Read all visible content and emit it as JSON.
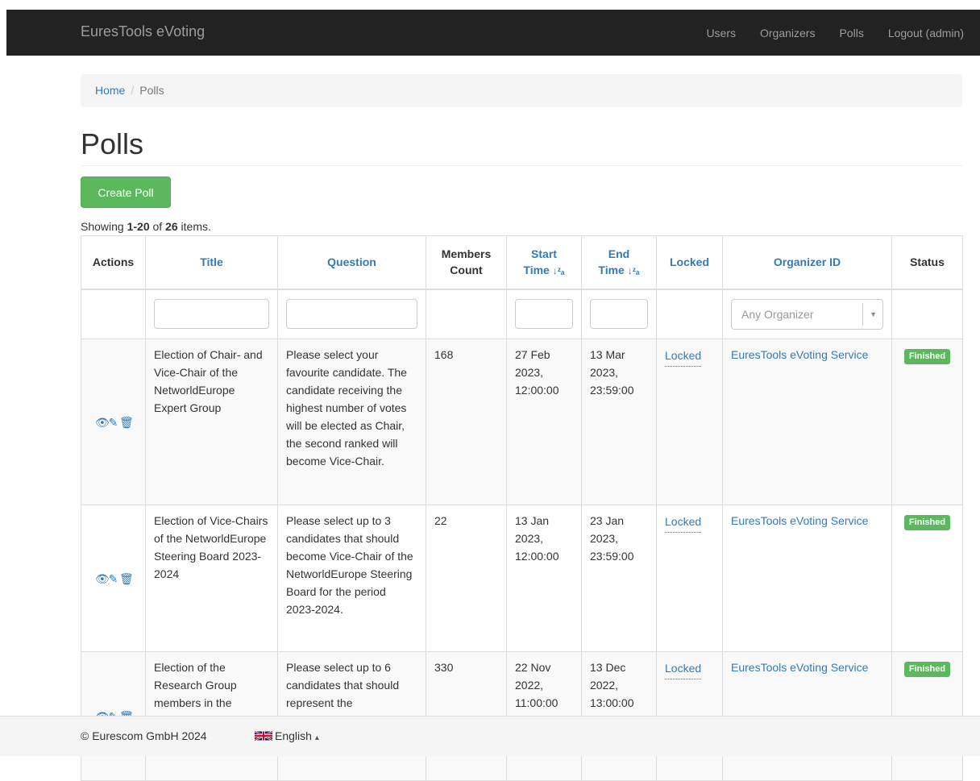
{
  "navbar": {
    "brand": "EuresTools eVoting",
    "links": [
      "Users",
      "Organizers",
      "Polls",
      "Logout (admin)"
    ]
  },
  "breadcrumb": {
    "home": "Home",
    "separator": "/",
    "current": "Polls"
  },
  "page": {
    "title": "Polls",
    "create_button": "Create Poll",
    "summary": {
      "prefix": "Showing ",
      "range": "1-20",
      "middle": " of ",
      "total": "26",
      "suffix": " items."
    }
  },
  "table": {
    "headers": {
      "actions": "Actions",
      "title": "Title",
      "question": "Question",
      "members_line1": "Members",
      "members_line2": "Count",
      "start_line1": "Start",
      "start_line2": "Time",
      "end_line1": "End",
      "end_line2": "Time",
      "locked": "Locked",
      "organizer": "Organizer ID",
      "status": "Status"
    },
    "filters": {
      "organizer_placeholder": "Any Organizer"
    },
    "rows": [
      {
        "title": "Election of Chair- and Vice-Chair of the NetworldEurope Expert Group",
        "question": "Please select your favourite candidate. The candidate receiving the highest number of votes will be elected as Chair, the second ranked will become Vice-Chair.",
        "members": "168",
        "start": "27 Feb 2023, 12:00:00",
        "end": "13 Mar 2023, 23:59:00",
        "locked": "Locked",
        "organizer": "EuresTools eVoting Service",
        "status": "Finished"
      },
      {
        "title": "Election of Vice-Chairs of the NetworldEurope Steering Board 2023-2024",
        "question": "Please select up to 3 candidates that should become Vice-Chair of the NetworldEurope Steering Board for the period 2023-2024.",
        "members": "22",
        "start": "13 Jan 2023, 12:00:00",
        "end": "23 Jan 2023, 23:59:00",
        "locked": "Locked",
        "organizer": "EuresTools eVoting Service",
        "status": "Finished"
      },
      {
        "title": "Election of the Research Group members in the NetworldEurope SRIA",
        "question": "Please select up to 6 candidates that should represent the",
        "members": "330",
        "start": "22 Nov 2022, 11:00:00",
        "end": "13 Dec 2022, 13:00:00",
        "locked": "Locked",
        "organizer": "EuresTools eVoting Service",
        "status": "Finished"
      }
    ]
  },
  "footer": {
    "copyright": "© Eurescom GmbH 2024",
    "language": "English",
    "language_caret": "▴"
  },
  "icons": {
    "view": "eye-icon",
    "edit": "pencil-icon",
    "delete": "trash-icon",
    "flag": "uk-flag-icon"
  },
  "colors": {
    "navbar": "#222222",
    "link": "#337ab7",
    "success": "#5cb85c"
  }
}
